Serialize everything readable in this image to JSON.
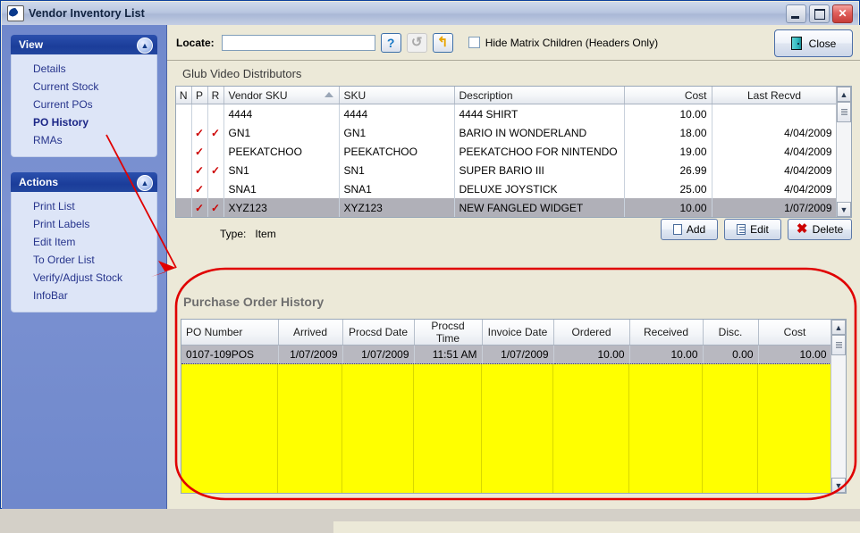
{
  "window": {
    "title": "Vendor Inventory List",
    "icon": "app-icon",
    "buttons": {
      "minimize": "–",
      "maximize": "□",
      "close": "✕"
    }
  },
  "sidebar": {
    "groups": [
      {
        "title": "View",
        "collapse_icon": "chevron-up-icon",
        "items": [
          {
            "label": "Details",
            "active": false
          },
          {
            "label": "Current Stock",
            "active": false
          },
          {
            "label": "Current POs",
            "active": false
          },
          {
            "label": "PO History",
            "active": true
          },
          {
            "label": "RMAs",
            "active": false
          }
        ]
      },
      {
        "title": "Actions",
        "collapse_icon": "chevron-up-icon",
        "items": [
          {
            "label": "Print List",
            "active": false
          },
          {
            "label": "Print Labels",
            "active": false
          },
          {
            "label": "Edit Item",
            "active": false
          },
          {
            "label": "To Order List",
            "active": false
          },
          {
            "label": "Verify/Adjust Stock",
            "active": false
          },
          {
            "label": "InfoBar",
            "active": false
          }
        ]
      }
    ]
  },
  "toolbar": {
    "locate_label": "Locate:",
    "locate_value": "",
    "locate_placeholder": "",
    "help_icon": "?",
    "refresh_icon": "↺",
    "goto_icon": "↰",
    "hide_matrix_label": "Hide Matrix Children (Headers Only)",
    "hide_matrix_checked": false,
    "close_label": "Close",
    "close_icon": "door-icon"
  },
  "main_grid": {
    "caption": "Glub Video Distributors",
    "sort_column": "Vendor SKU",
    "columns": [
      "N",
      "P",
      "R",
      "Vendor SKU",
      "SKU",
      "Description",
      "Cost",
      "Last Recvd"
    ],
    "rows": [
      {
        "n": "",
        "p": "",
        "r": "",
        "vendor_sku": "4444",
        "sku": "4444",
        "description": "4444 SHIRT",
        "cost": "10.00",
        "last_recvd": "",
        "selected": false
      },
      {
        "n": "",
        "p": "✓",
        "r": "✓",
        "vendor_sku": "GN1",
        "sku": "GN1",
        "description": "BARIO IN WONDERLAND",
        "cost": "18.00",
        "last_recvd": "4/04/2009",
        "selected": false
      },
      {
        "n": "",
        "p": "✓",
        "r": "",
        "vendor_sku": "PEEKATCHOO",
        "sku": "PEEKATCHOO",
        "description": "PEEKATCHOO FOR NINTENDO",
        "cost": "19.00",
        "last_recvd": "4/04/2009",
        "selected": false
      },
      {
        "n": "",
        "p": "✓",
        "r": "✓",
        "vendor_sku": "SN1",
        "sku": "SN1",
        "description": "SUPER BARIO III",
        "cost": "26.99",
        "last_recvd": "4/04/2009",
        "selected": false
      },
      {
        "n": "",
        "p": "✓",
        "r": "",
        "vendor_sku": "SNA1",
        "sku": "SNA1",
        "description": "DELUXE JOYSTICK",
        "cost": "25.00",
        "last_recvd": "4/04/2009",
        "selected": false
      },
      {
        "n": "",
        "p": "✓",
        "r": "✓",
        "vendor_sku": "XYZ123",
        "sku": "XYZ123",
        "description": "NEW FANGLED WIDGET",
        "cost": "10.00",
        "last_recvd": "1/07/2009",
        "selected": true
      }
    ],
    "scroll_up_icon": "▲",
    "scroll_down_icon": "▼"
  },
  "detail_bar": {
    "type_label": "Type:",
    "type_value": "Item",
    "buttons": [
      {
        "label": "Add",
        "icon": "new-document-icon"
      },
      {
        "label": "Edit",
        "icon": "edit-document-icon"
      },
      {
        "label": "Delete",
        "icon": "red-x-icon"
      }
    ]
  },
  "po_history": {
    "title": "Purchase Order History",
    "columns": [
      "PO Number",
      "Arrived",
      "Procsd Date",
      "Procsd Time",
      "Invoice Date",
      "Ordered",
      "Received",
      "Disc.",
      "Cost"
    ],
    "rows": [
      {
        "po_number": "0107-109POS",
        "arrived": "1/07/2009",
        "procsd_date": "1/07/2009",
        "procsd_time": "11:51 AM",
        "invoice_date": "1/07/2009",
        "ordered": "10.00",
        "received": "10.00",
        "disc": "0.00",
        "cost": "10.00",
        "selected": true
      }
    ],
    "empty_area_color": "#ffff00",
    "scroll_up_icon": "▲",
    "scroll_down_icon": "▼"
  },
  "annotations": {
    "highlight_color": "#e00000",
    "arrow": "points from PO History nav item to Purchase Order History panel",
    "ellipse": "surrounds Purchase Order History panel"
  }
}
